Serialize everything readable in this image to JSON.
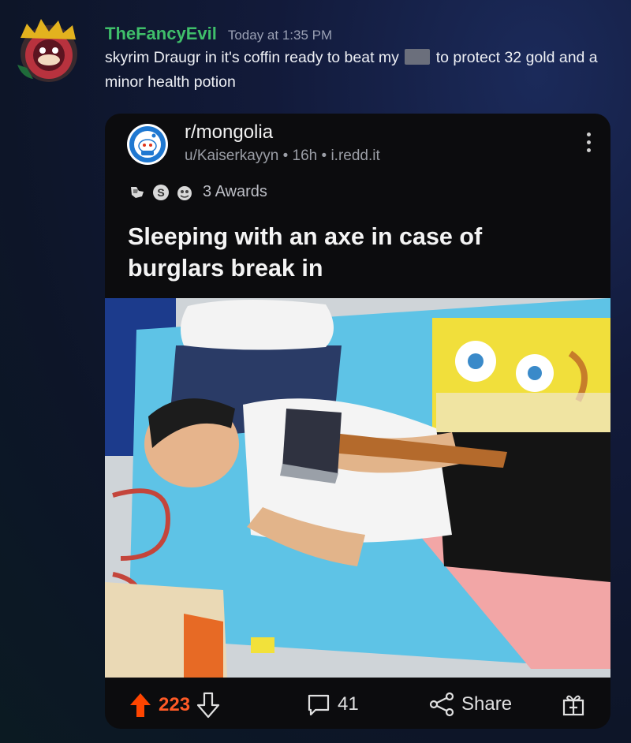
{
  "message": {
    "username": "TheFancyEvil",
    "timestamp": "Today at 1:35 PM",
    "text_part1": "skyrim Draugr in it's coffin ready to beat my",
    "text_part2": "to protect 32 gold and a minor health potion",
    "username_color": "#3fbf6a"
  },
  "post": {
    "subreddit": "r/mongolia",
    "meta": "u/Kaiserkayyn • 16h • i.redd.it",
    "awards_text": "3 Awards",
    "title": "Sleeping with an axe in case of burglars break in",
    "image_alt": "photo of a person lying on a SpongeBob blanket holding an axe"
  },
  "actions": {
    "upvotes": "223",
    "comments": "41",
    "share_label": "Share",
    "upvote_color": "#ff5a26"
  },
  "icons": [
    "avatar",
    "subreddit-icon",
    "more-options-icon",
    "award-icon",
    "upvote-icon",
    "downvote-icon",
    "comment-icon",
    "share-icon",
    "gift-icon"
  ]
}
